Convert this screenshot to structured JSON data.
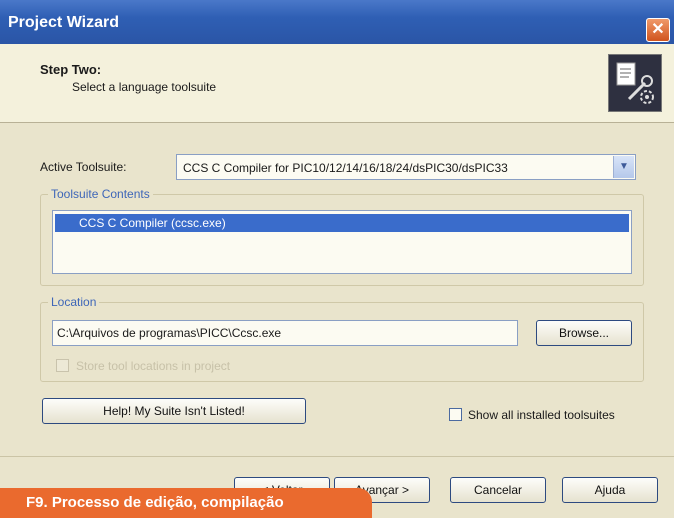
{
  "window": {
    "title": "Project Wizard",
    "close_glyph": "✕"
  },
  "header": {
    "step_title": "Step Two:",
    "step_subtitle": "Select a language toolsuite",
    "icon": "wizard-tools-icon"
  },
  "toolsuite": {
    "label": "Active Toolsuite:",
    "selected": "CCS C Compiler for PIC10/12/14/16/18/24/dsPIC30/dsPIC33",
    "dropdown_glyph": "▼"
  },
  "contents": {
    "caption": "Toolsuite Contents",
    "items": [
      "CCS C Compiler (ccsc.exe)"
    ]
  },
  "location": {
    "caption": "Location",
    "value": "C:\\Arquivos de programas\\PICC\\Ccsc.exe",
    "browse_label": "Browse...",
    "store_label": "Store tool locations in project"
  },
  "help_button_label": "Help!  My Suite Isn't Listed!",
  "show_all_label": "Show all installed toolsuites",
  "nav": {
    "back": "< Voltar",
    "next": "Avançar >",
    "cancel": "Cancelar",
    "help": "Ajuda"
  },
  "caption_overlay": "F9. Processo de edição, compilação",
  "colors": {
    "accent": "#2f5fb4",
    "selection": "#3a6ccb",
    "caption": "#ea6a2e"
  }
}
